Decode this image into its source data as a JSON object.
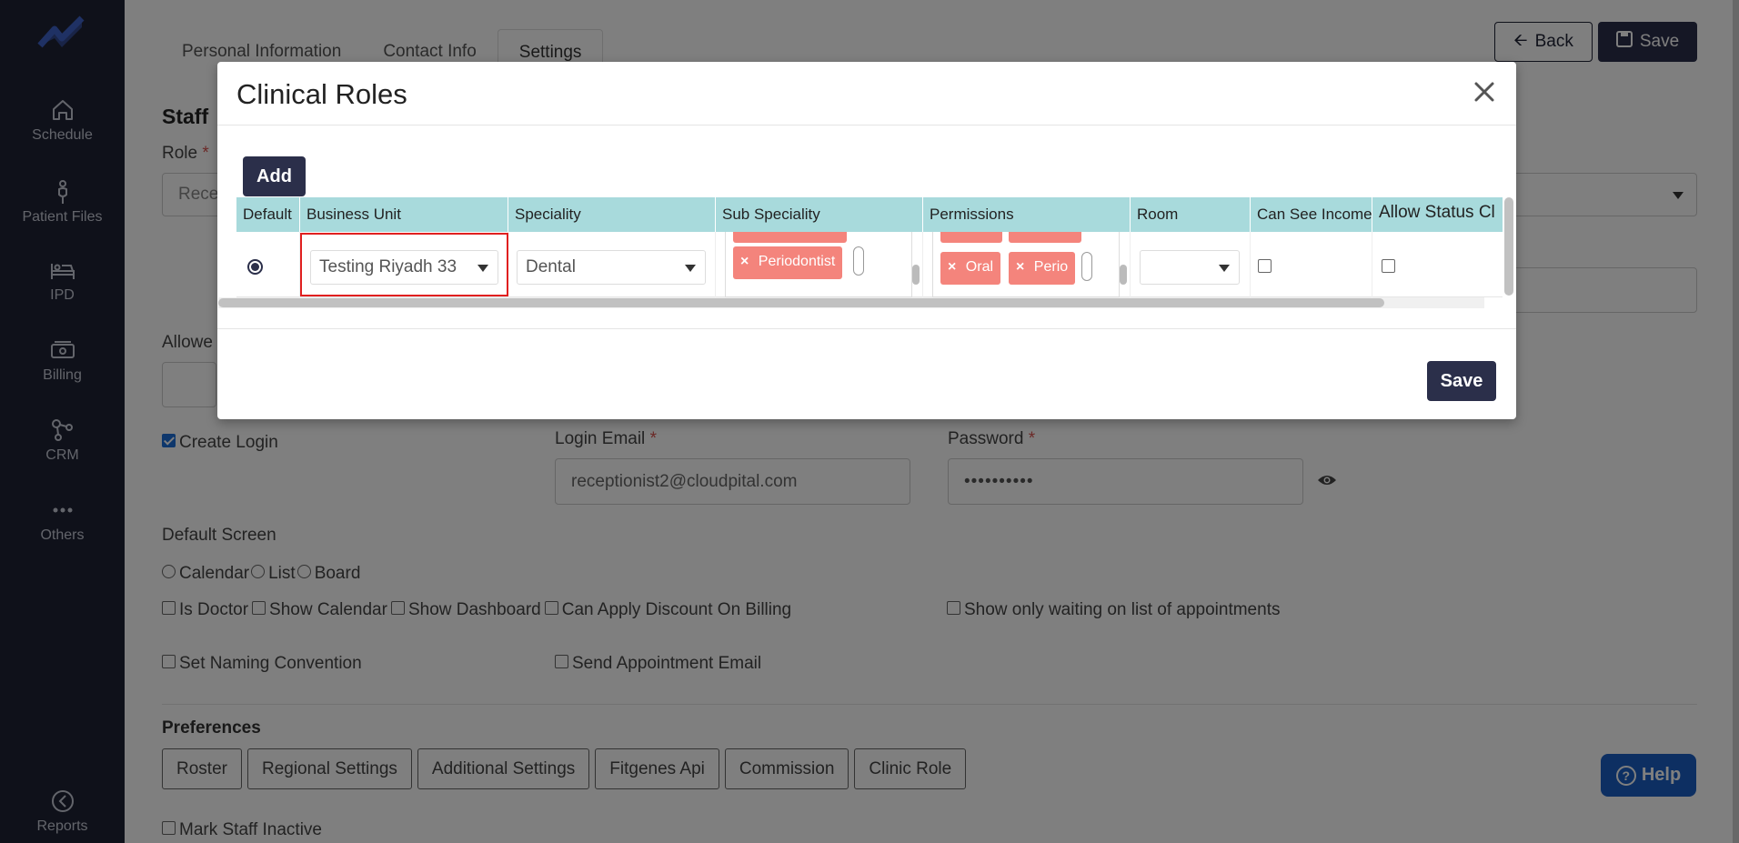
{
  "sidebar": {
    "items": [
      {
        "label": "Schedule",
        "icon": "home-icon"
      },
      {
        "label": "Patient Files",
        "icon": "stethoscope-icon"
      },
      {
        "label": "IPD",
        "icon": "bed-icon"
      },
      {
        "label": "Billing",
        "icon": "money-icon"
      },
      {
        "label": "CRM",
        "icon": "network-icon"
      },
      {
        "label": "Others",
        "icon": "dots-icon"
      },
      {
        "label": "Reports",
        "icon": "reports-icon"
      }
    ]
  },
  "tabs": [
    "Personal Information",
    "Contact Info",
    "Settings"
  ],
  "header": {
    "back_label": "Back",
    "save_label": "Save"
  },
  "form": {
    "section_title": "Staff",
    "role_label": "Role",
    "role_value": "Rece",
    "allowed_label": "Allowe",
    "create_login_label": "Create Login",
    "login_email_label": "Login Email",
    "login_email_value": "receptionist2@cloudpital.com",
    "password_label": "Password",
    "password_value": "••••••••••",
    "default_screen_label": "Default Screen",
    "default_screen_options": [
      "Calendar",
      "List",
      "Board"
    ],
    "checks_row1": [
      "Is Doctor",
      "Show Calendar",
      "Show Dashboard",
      "Can Apply Discount On Billing"
    ],
    "show_waiting_label": "Show only waiting on list of appointments",
    "set_naming_label": "Set Naming Convention",
    "send_email_label": "Send Appointment Email",
    "preferences_label": "Preferences",
    "preference_buttons": [
      "Roster",
      "Regional Settings",
      "Additional Settings",
      "Fitgenes Api",
      "Commission",
      "Clinic Role"
    ],
    "mark_inactive_label": "Mark Staff Inactive"
  },
  "help_label": "Help",
  "modal": {
    "title": "Clinical Roles",
    "add_label": "Add",
    "save_label": "Save",
    "columns": [
      "Default",
      "Business Unit",
      "Speciality",
      "Sub Speciality",
      "Permissions",
      "Room",
      "Can See Income",
      "Allow Status Cl"
    ],
    "row": {
      "business_unit": "Testing Riyadh 33",
      "speciality": "Dental",
      "sub_speciality_tags": [
        "Periodontist"
      ],
      "permission_tags": [
        "Oral",
        "Perio"
      ],
      "tag_remove": "×"
    }
  },
  "colors": {
    "sidebar_bg": "#1f2235",
    "primary": "#2b2f4a",
    "table_header": "#a8dadc",
    "tag": "#f4847c",
    "highlight": "#e02020",
    "help": "#1a5fc4"
  }
}
